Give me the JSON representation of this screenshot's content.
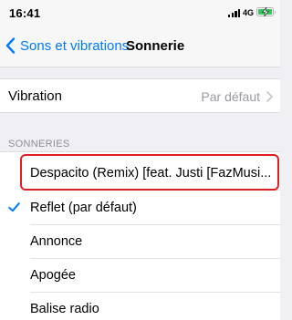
{
  "status_bar": {
    "time": "16:41",
    "network": "4G"
  },
  "nav": {
    "back_label": "Sons et vibrations",
    "title": "Sonnerie"
  },
  "vibration": {
    "label": "Vibration",
    "value": "Par défaut"
  },
  "section": {
    "header": "SONNERIES"
  },
  "ringtones": [
    {
      "label": "Despacito (Remix) [feat. Justi [FazMusi...",
      "selected": false,
      "highlighted": true
    },
    {
      "label": "Reflet (par défaut)",
      "selected": true
    },
    {
      "label": "Annonce",
      "selected": false
    },
    {
      "label": "Apogée",
      "selected": false
    },
    {
      "label": "Balise radio",
      "selected": false
    }
  ],
  "colors": {
    "accent": "#007aff",
    "highlight_border": "#e01e24",
    "battery": "#34c759",
    "background": "#efeff4"
  }
}
